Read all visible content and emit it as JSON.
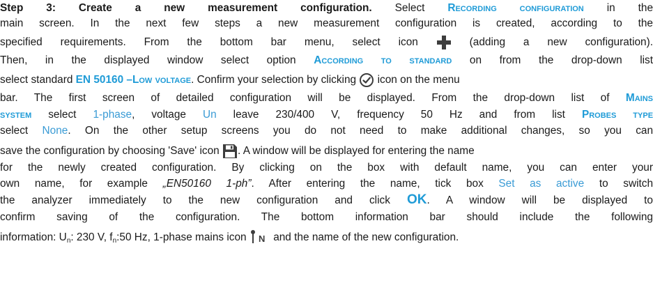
{
  "step": {
    "title": "Step 3: Create a new measurement configuration.",
    "l1_a": "Select",
    "kw_recording": "Recording configuration",
    "l1_b": "in the",
    "l2": "main screen. In the next few steps a new measurement configuration is created, according to the",
    "l3_a": "specified requirements. From the bottom bar menu, select icon",
    "l3_b": "(adding a new configuration).",
    "l4_a": "Then, in the displayed window select option",
    "kw_according": "According to standard",
    "l4_b": "on from the drop-down list",
    "l5_a": "select standard",
    "kw_en_num": "EN 50160 –",
    "kw_en_sc": "Low voltage",
    "l5_b": ". Confirm your selection by clicking",
    "l5_c": "icon on the menu",
    "l6_a": "bar. The first screen of detailed configuration will be displayed. From the drop-down list of",
    "kw_mains": "Mains",
    "kw_system": "system",
    "l7_a": "select",
    "opt_1phase": "1-phase",
    "l7_b": ", voltage",
    "opt_un": "Un",
    "l7_c": "leave 230/400 V, frequency 50 Hz and from list",
    "kw_probes": "Probes type",
    "l8_a": "select",
    "opt_none": "None",
    "l8_b": ". On the other setup screens you do not need to make additional changes, so you can",
    "l9_a": "save the configuration by choosing 'Save' icon",
    "l9_b": ". A window will be displayed for entering the name",
    "l10": "for the newly created configuration. By clicking on the box with default name, you can enter your",
    "l11_a": "own name, for example",
    "name_example": "„EN50160 1-ph”",
    "l11_b": ". After entering the name, tick box",
    "opt_active": "Set as active",
    "l11_c": "to switch",
    "l12_a": "the analyzer immediately to the new configuration and click",
    "ok_label": "OK",
    "l12_b": ". A window will be displayed to",
    "l13": "confirm saving of the configuration. The bottom information bar should include the following",
    "l14_a": "information: U",
    "l14_sub_n1": "n",
    "l14_b": ": 230 V, f",
    "l14_sub_n2": "n",
    "l14_c": ":50 Hz, 1-phase mains icon",
    "l14_d": "and the name of the new configuration."
  },
  "icons": {
    "add": "plus-icon",
    "confirm": "checkmark-circle-icon",
    "save": "floppy-disk-icon",
    "mains": "single-phase-mains-icon",
    "icon_color": "#3d3d3d",
    "accent": "#1f9bd7"
  }
}
